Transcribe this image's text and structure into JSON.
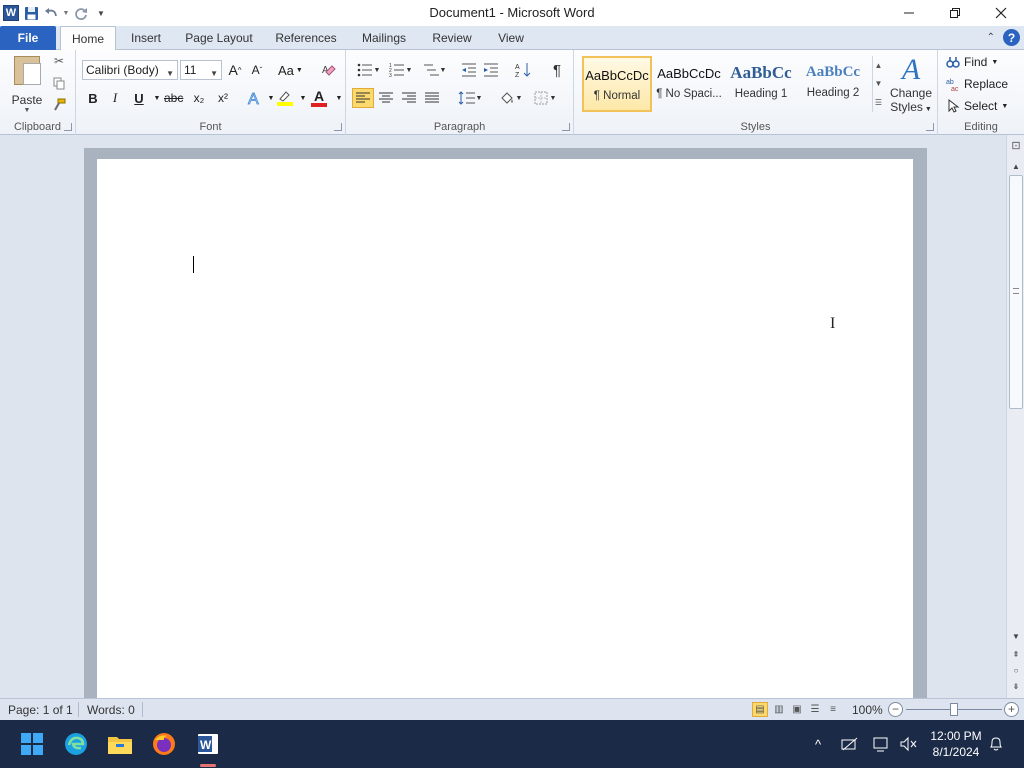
{
  "app": {
    "title": "Document1 - Microsoft Word",
    "logo_letter": "W"
  },
  "tabs": [
    {
      "label": "File"
    },
    {
      "label": "Home"
    },
    {
      "label": "Insert"
    },
    {
      "label": "Page Layout"
    },
    {
      "label": "References"
    },
    {
      "label": "Mailings"
    },
    {
      "label": "Review"
    },
    {
      "label": "View"
    }
  ],
  "ribbon": {
    "clipboard": {
      "label": "Clipboard",
      "paste_label": "Paste"
    },
    "font": {
      "label": "Font",
      "font_name": "Calibri (Body)",
      "font_size": "11",
      "bold": "B",
      "italic": "I",
      "underline": "U",
      "strike": "abc",
      "subscript": "x₂",
      "superscript": "x²",
      "case": "Aa",
      "font_color_letter": "A"
    },
    "paragraph": {
      "label": "Paragraph",
      "pilcrow": "¶"
    },
    "styles": {
      "label": "Styles",
      "items": [
        {
          "preview": "AaBbCcDc",
          "name": "¶ Normal"
        },
        {
          "preview": "AaBbCcDc",
          "name": "¶ No Spaci..."
        },
        {
          "preview": "AaBbCc",
          "name": "Heading 1"
        },
        {
          "preview": "AaBbCc",
          "name": "Heading 2"
        }
      ],
      "change_styles_line1": "Change",
      "change_styles_line2": "Styles"
    },
    "editing": {
      "label": "Editing",
      "find": "Find",
      "replace": "Replace",
      "select": "Select"
    }
  },
  "status": {
    "page": "Page: 1 of 1",
    "words": "Words: 0",
    "zoom": "100%"
  },
  "taskbar": {
    "time": "12:00 PM",
    "date": "8/1/2024"
  },
  "colors": {
    "file_tab": "#2a63c0",
    "accent_yellow": "#fbd96c",
    "taskbar": "#1b2a46"
  }
}
